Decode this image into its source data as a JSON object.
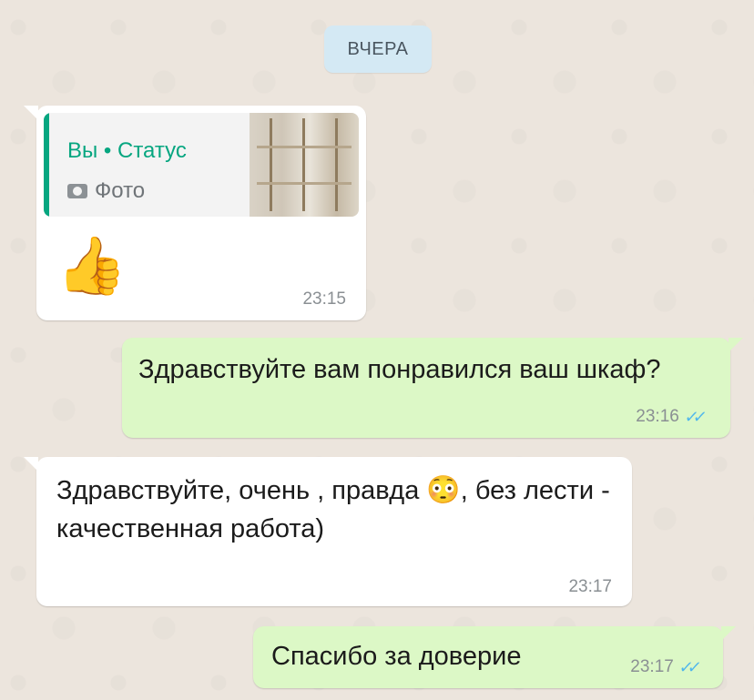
{
  "chat": {
    "date_label": "ВЧЕРА",
    "messages": [
      {
        "direction": "incoming",
        "quote": {
          "author": "Вы • Статус",
          "type_label": "Фото",
          "type_icon": "camera-icon"
        },
        "content_emoji": "👍",
        "time": "23:15"
      },
      {
        "direction": "outgoing",
        "text": "Здравствуйте вам понравился ваш шкаф?",
        "time": "23:16",
        "status": "read",
        "status_icon": "double-check-icon"
      },
      {
        "direction": "incoming",
        "text_part1": "Здравствуйте, очень , правда ",
        "emoji": "😳",
        "text_part2": ", без лести - качественная работа)",
        "time": "23:17"
      },
      {
        "direction": "outgoing",
        "text": "Спасибо за доверие",
        "time": "23:17",
        "status": "read",
        "status_icon": "double-check-icon"
      }
    ]
  },
  "colors": {
    "wallpaper": "#ece5dd",
    "incoming_bubble": "#ffffff",
    "outgoing_bubble": "#dcf8c6",
    "quote_accent": "#06a680",
    "read_check": "#4fb6ec",
    "date_chip": "#d4e9f4"
  }
}
